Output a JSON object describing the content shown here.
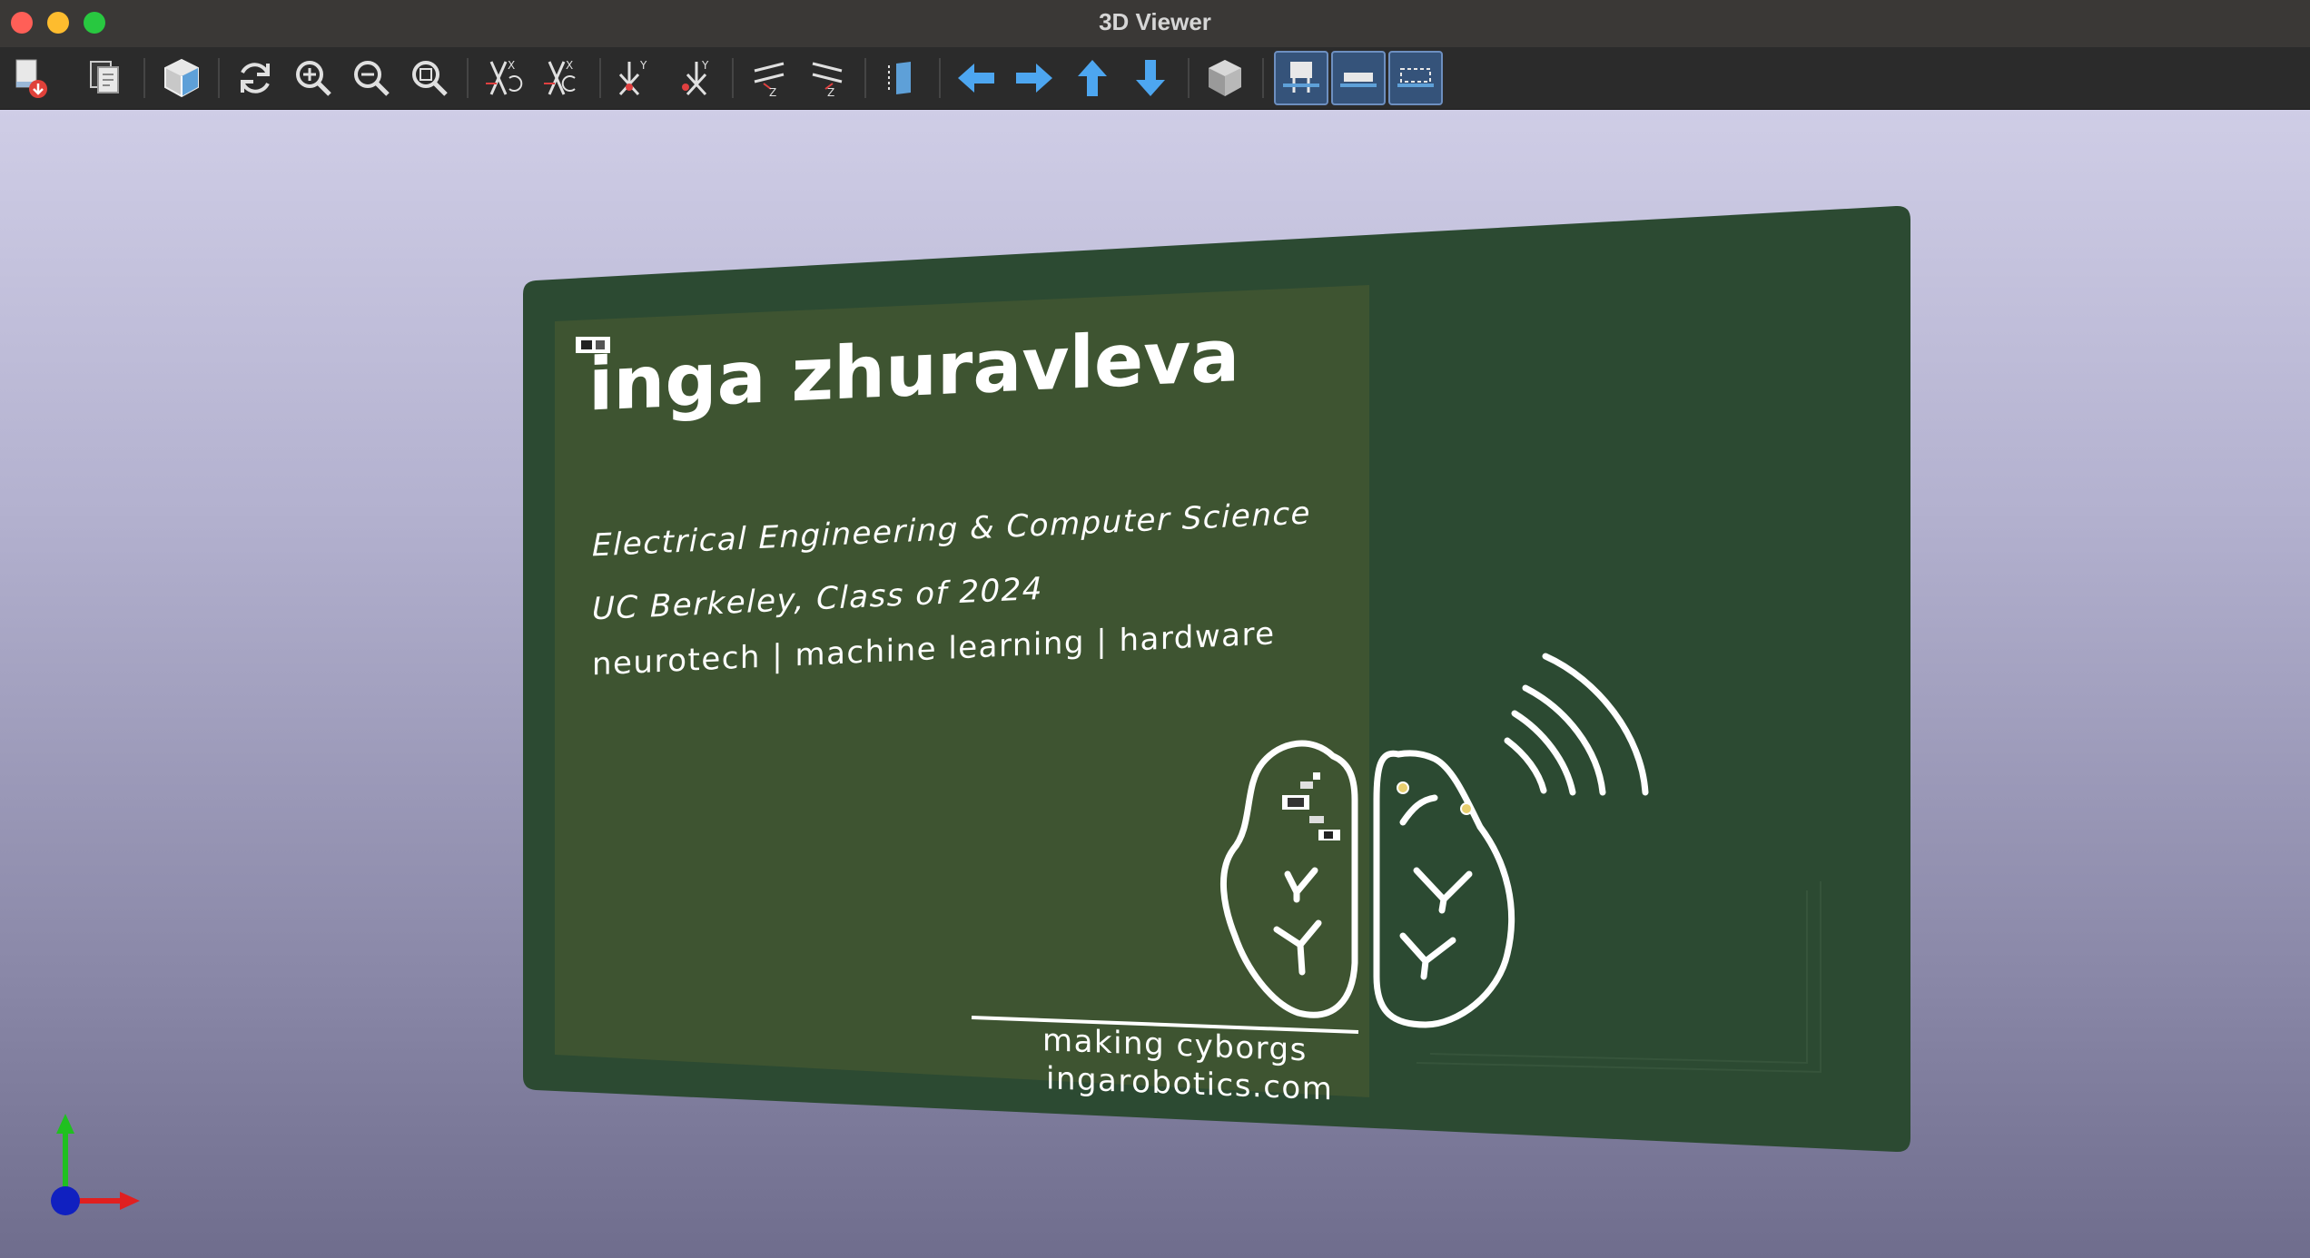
{
  "window": {
    "title": "3D Viewer"
  },
  "toolbar": {
    "buttons": [
      {
        "name": "export-button",
        "icon": "export-icon"
      },
      {
        "name": "copy-button",
        "icon": "copy-icon"
      },
      {
        "name": "render-options-button",
        "icon": "raytrace-cube-icon"
      },
      {
        "name": "reload-button",
        "icon": "reload-icon"
      },
      {
        "name": "zoom-in-button",
        "icon": "zoom-in-icon"
      },
      {
        "name": "zoom-out-button",
        "icon": "zoom-out-icon"
      },
      {
        "name": "zoom-fit-button",
        "icon": "zoom-fit-icon"
      },
      {
        "name": "rotate-x-cw-button",
        "icon": "rotate-x-cw-icon"
      },
      {
        "name": "rotate-x-ccw-button",
        "icon": "rotate-x-ccw-icon"
      },
      {
        "name": "rotate-y-cw-button",
        "icon": "rotate-y-cw-icon"
      },
      {
        "name": "rotate-y-ccw-button",
        "icon": "rotate-y-ccw-icon"
      },
      {
        "name": "rotate-z-cw-button",
        "icon": "rotate-z-cw-icon"
      },
      {
        "name": "rotate-z-ccw-button",
        "icon": "rotate-z-ccw-icon"
      },
      {
        "name": "flip-board-button",
        "icon": "flip-board-icon"
      },
      {
        "name": "move-left-button",
        "icon": "arrow-left-icon"
      },
      {
        "name": "move-right-button",
        "icon": "arrow-right-icon"
      },
      {
        "name": "move-up-button",
        "icon": "arrow-up-icon"
      },
      {
        "name": "move-down-button",
        "icon": "arrow-down-icon"
      },
      {
        "name": "orthographic-button",
        "icon": "cube-icon"
      },
      {
        "name": "show-tht-button",
        "icon": "tht-component-icon"
      },
      {
        "name": "show-smd-button",
        "icon": "smd-component-icon"
      },
      {
        "name": "show-virtual-button",
        "icon": "virtual-component-icon"
      }
    ]
  },
  "board": {
    "name": "inga zhuravleva",
    "line1": "Electrical Engineering & Computer Science",
    "line2": "UC Berkeley, Class of 2024",
    "line3": "neurotech | machine learning | hardware",
    "tagline": "making cyborgs",
    "website": "ingarobotics.com",
    "colors": {
      "board": "#2c4a32",
      "panel": "#3e5431",
      "silkscreen": "#ffffff"
    }
  },
  "axes": {
    "colors": {
      "x": "#e02020",
      "y": "#20c020",
      "z": "#1020c0"
    }
  }
}
